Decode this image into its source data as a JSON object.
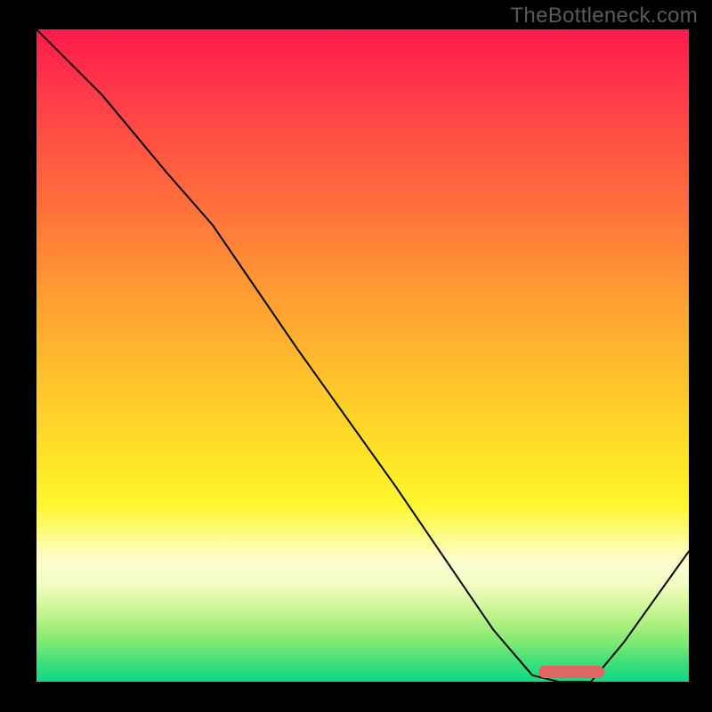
{
  "watermark": "TheBottleneck.com",
  "colors": {
    "frame_bg": "#000000",
    "watermark_text": "#5a5a5a",
    "curve": "#000000",
    "marker": "#e06666",
    "gradient_top": "#ff1a4d",
    "gradient_bottom": "#0fd884"
  },
  "chart_data": {
    "type": "line",
    "title": "",
    "xlabel": "",
    "ylabel": "",
    "xlim": [
      0,
      100
    ],
    "ylim": [
      0,
      100
    ],
    "grid": false,
    "series": [
      {
        "name": "curve",
        "x": [
          0,
          10,
          20,
          27,
          40,
          55,
          70,
          76,
          80,
          85,
          90,
          100
        ],
        "y": [
          100,
          90,
          78,
          70,
          51,
          30,
          8,
          1,
          0,
          0,
          6,
          20
        ]
      }
    ],
    "annotations": [
      {
        "name": "optimal-range-marker",
        "x_start": 77,
        "x_end": 87,
        "y": 1.5
      }
    ],
    "background_gradient_stops": [
      {
        "pct": 0,
        "color": "#ff1a4d"
      },
      {
        "pct": 25,
        "color": "#ff6a3d"
      },
      {
        "pct": 55,
        "color": "#ffc62b"
      },
      {
        "pct": 80,
        "color": "#fefcb5"
      },
      {
        "pct": 100,
        "color": "#0fd884"
      }
    ]
  }
}
